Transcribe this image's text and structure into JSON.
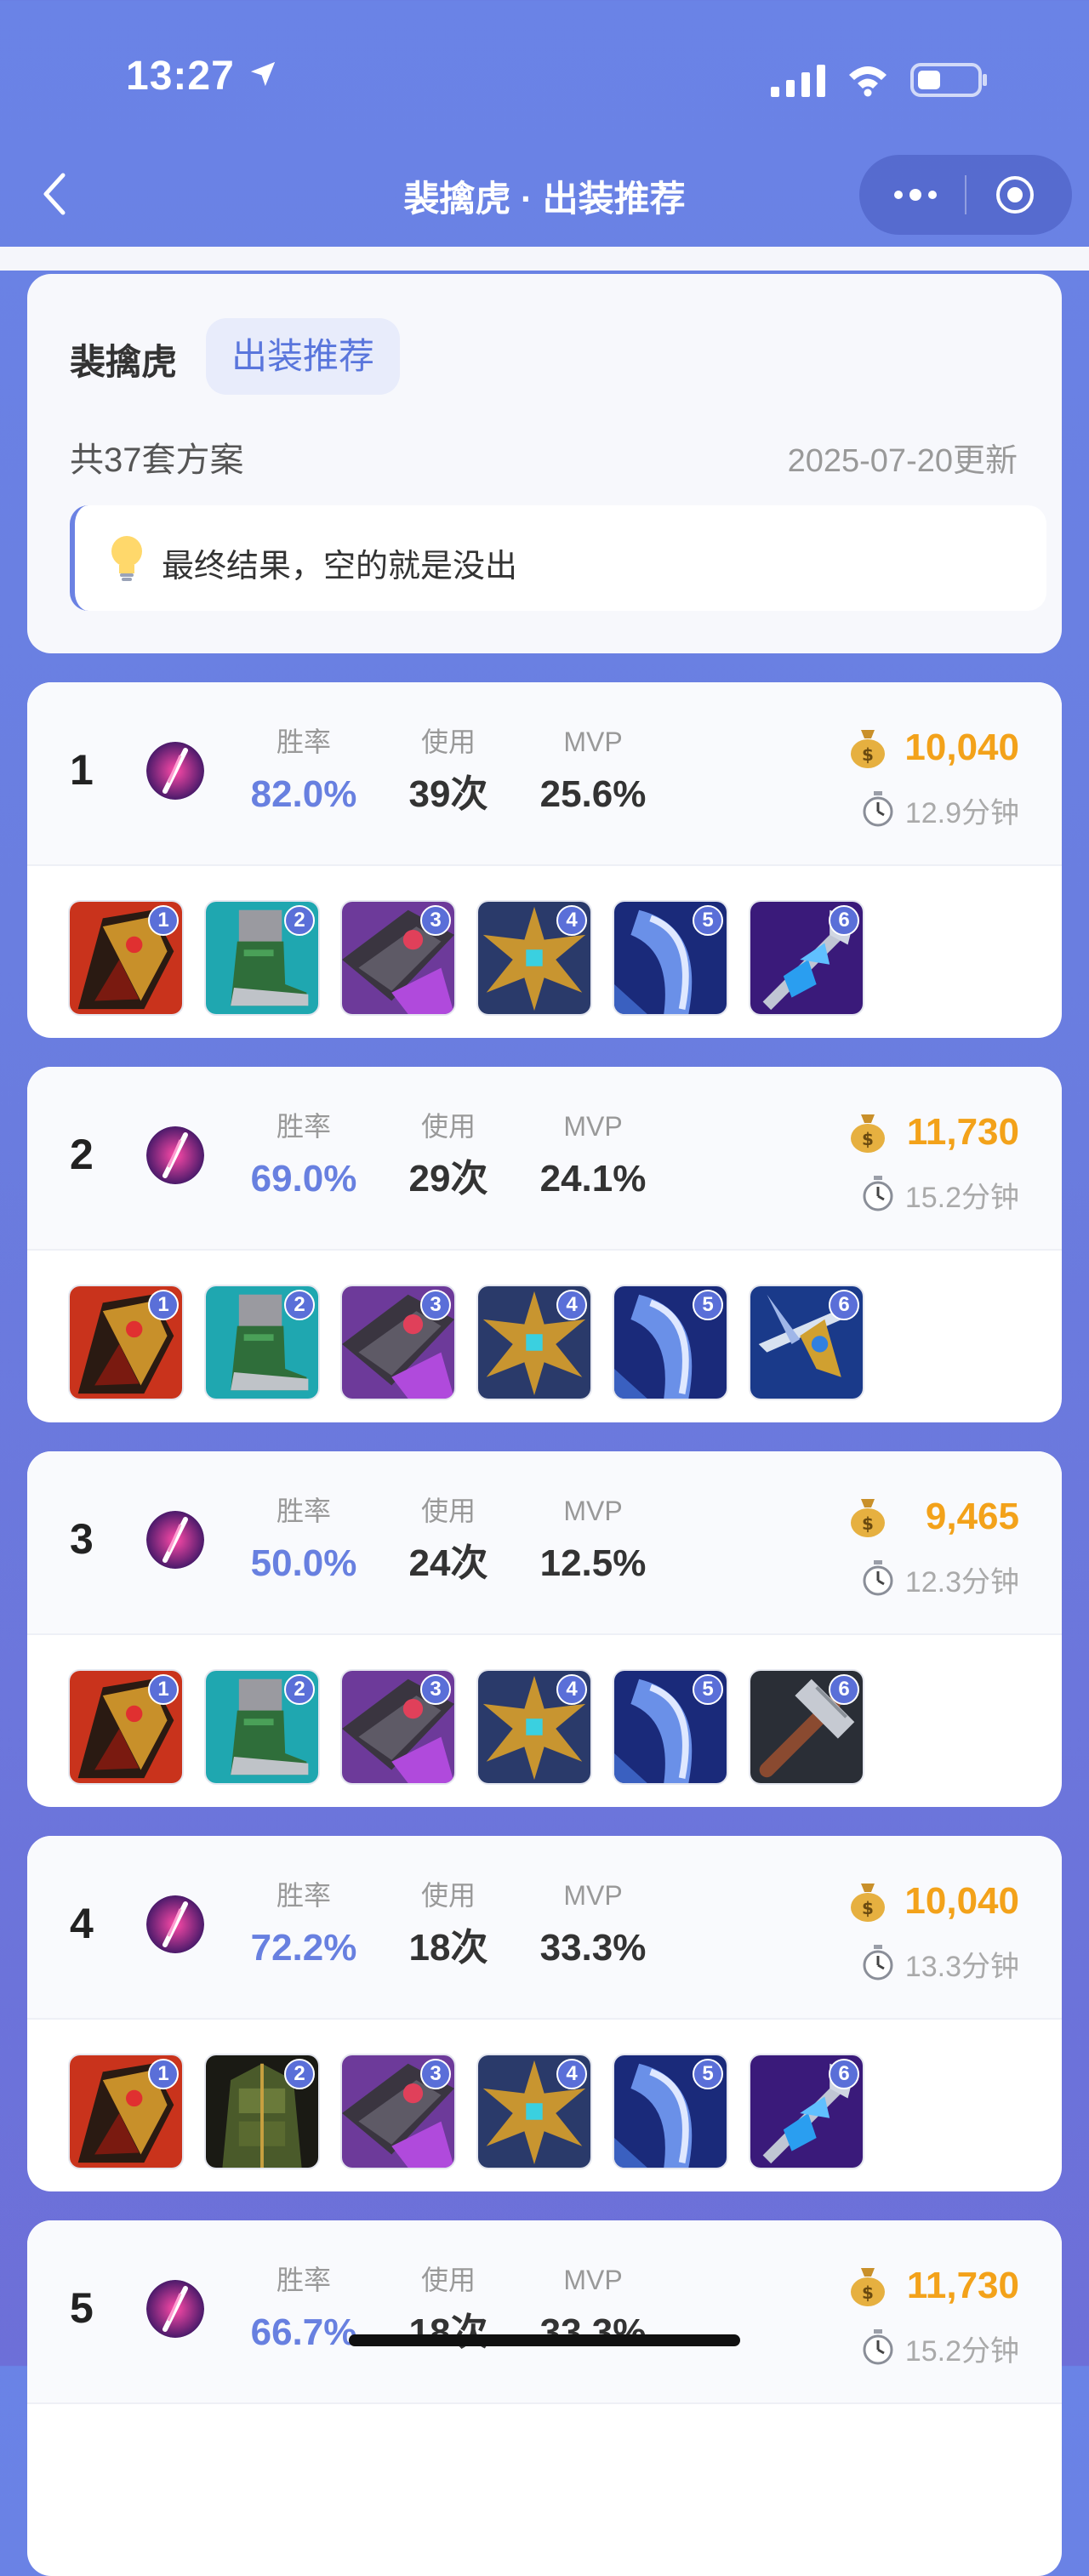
{
  "status_bar": {
    "time": "13:27"
  },
  "nav": {
    "title": "裴擒虎 · 出装推荐"
  },
  "header": {
    "hero_name": "裴擒虎",
    "tag": "出装推荐",
    "plan_count": "共37套方案",
    "update_date": "2025-07-20更新",
    "tip": "最终结果，空的就是没出"
  },
  "stat_labels": {
    "win_rate": "胜率",
    "usage": "使用",
    "mvp": "MVP"
  },
  "colors": {
    "accent": "#6880e0",
    "price": "#f3a21a",
    "background": "#6a83e6"
  },
  "builds": [
    {
      "rank": "1",
      "win_rate": "82.0%",
      "usage": "39次",
      "mvp": "25.6%",
      "price": "10,040",
      "duration": "12.9分钟",
      "items": [
        {
          "num": "1",
          "icon": "red-gold-armor-item-icon"
        },
        {
          "num": "2",
          "icon": "green-boots-item-icon"
        },
        {
          "num": "3",
          "icon": "purple-blade-item-icon"
        },
        {
          "num": "4",
          "icon": "golden-thorns-item-icon"
        },
        {
          "num": "5",
          "icon": "blue-axe-item-icon"
        },
        {
          "num": "6",
          "icon": "ice-scepter-item-icon"
        }
      ]
    },
    {
      "rank": "2",
      "win_rate": "69.0%",
      "usage": "29次",
      "mvp": "24.1%",
      "price": "11,730",
      "duration": "15.2分钟",
      "items": [
        {
          "num": "1",
          "icon": "red-gold-armor-item-icon"
        },
        {
          "num": "2",
          "icon": "green-boots-item-icon"
        },
        {
          "num": "3",
          "icon": "purple-blade-item-icon"
        },
        {
          "num": "4",
          "icon": "golden-thorns-item-icon"
        },
        {
          "num": "5",
          "icon": "blue-axe-item-icon"
        },
        {
          "num": "6",
          "icon": "golden-spear-item-icon"
        }
      ]
    },
    {
      "rank": "3",
      "win_rate": "50.0%",
      "usage": "24次",
      "mvp": "12.5%",
      "price": "9,465",
      "duration": "12.3分钟",
      "items": [
        {
          "num": "1",
          "icon": "red-gold-armor-item-icon"
        },
        {
          "num": "2",
          "icon": "green-boots-item-icon"
        },
        {
          "num": "3",
          "icon": "purple-blade-item-icon"
        },
        {
          "num": "4",
          "icon": "golden-thorns-item-icon"
        },
        {
          "num": "5",
          "icon": "blue-axe-item-icon"
        },
        {
          "num": "6",
          "icon": "iron-hammer-item-icon"
        }
      ]
    },
    {
      "rank": "4",
      "win_rate": "72.2%",
      "usage": "18次",
      "mvp": "33.3%",
      "price": "10,040",
      "duration": "13.3分钟",
      "items": [
        {
          "num": "1",
          "icon": "red-gold-armor-item-icon"
        },
        {
          "num": "2",
          "icon": "dark-green-armor-item-icon"
        },
        {
          "num": "3",
          "icon": "purple-blade-item-icon"
        },
        {
          "num": "4",
          "icon": "golden-thorns-item-icon"
        },
        {
          "num": "5",
          "icon": "blue-axe-item-icon"
        },
        {
          "num": "6",
          "icon": "ice-scepter-item-icon"
        }
      ]
    },
    {
      "rank": "5",
      "win_rate": "66.7%",
      "usage": "18次",
      "mvp": "33.3%",
      "price": "11,730",
      "duration": "15.2分钟",
      "items": []
    }
  ]
}
